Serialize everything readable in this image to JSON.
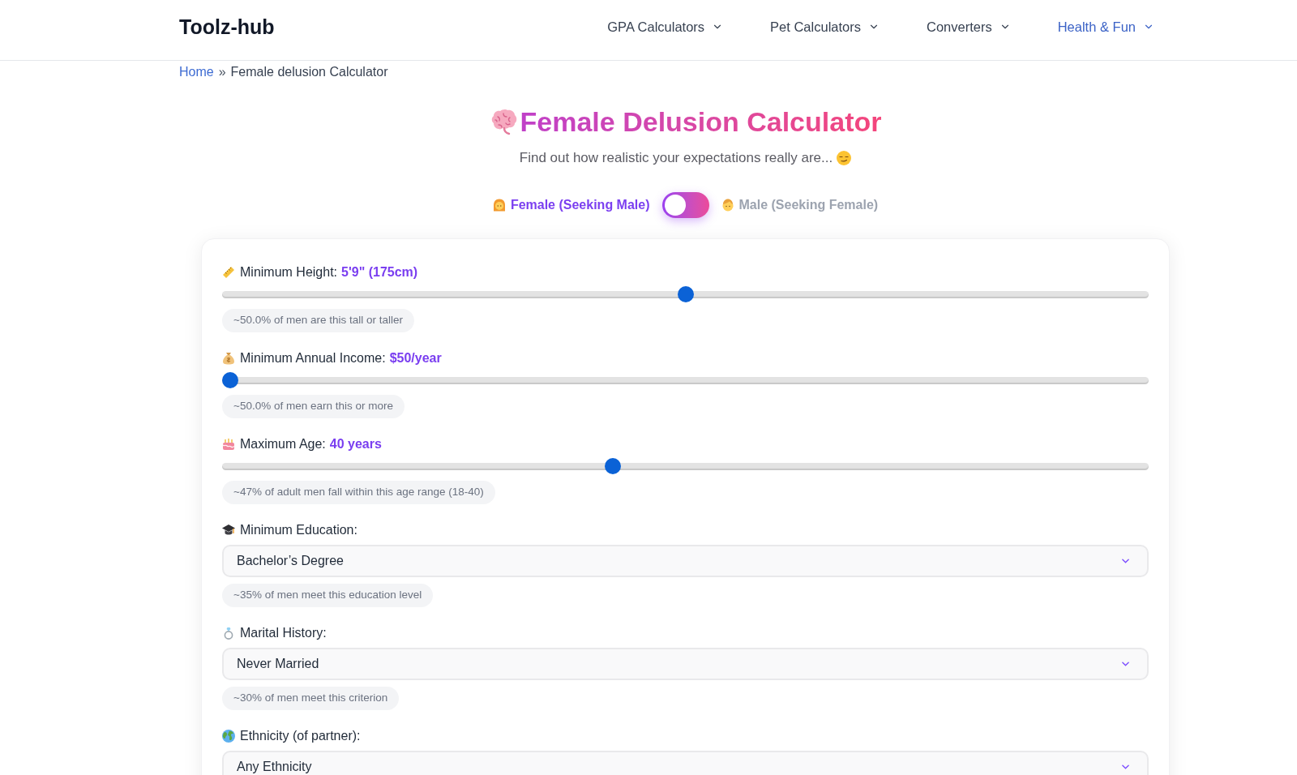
{
  "header": {
    "logo": "Toolz-hub",
    "nav": [
      {
        "label": "GPA Calculators",
        "selected": false
      },
      {
        "label": "Pet Calculators",
        "selected": false
      },
      {
        "label": "Converters",
        "selected": false
      },
      {
        "label": "Health & Fun",
        "selected": true
      }
    ]
  },
  "breadcrumb": {
    "links": [
      "Home"
    ],
    "separator": "»",
    "current": "Female delusion Calculator"
  },
  "hero": {
    "title": "Female Delusion Calculator",
    "subtitle": "Find out how realistic your expectations really are..."
  },
  "modes": [
    {
      "label": "Female (Seeking Male)",
      "selected": true
    },
    {
      "label": "Male (Seeking Female)",
      "selected": false
    }
  ],
  "criteria": [
    {
      "kind": "slider",
      "label": "Minimum Height:",
      "value": "5'9\" (175cm)",
      "level": 0.5,
      "note": "~50.0% of men are this tall or taller"
    },
    {
      "kind": "slider",
      "label": "Minimum Annual Income:",
      "value": "$50/year",
      "level": 0,
      "note": "~50.0% of men earn this or more"
    },
    {
      "kind": "slider",
      "label": "Maximum Age:",
      "value": "40 years",
      "level": 0.42,
      "note": "~47% of adult men fall within this age range (18-40)"
    },
    {
      "kind": "select",
      "label": "Minimum Education:",
      "value": "Bachelor’s Degree",
      "note": "~35% of men meet this education level"
    },
    {
      "kind": "select",
      "label": "Marital History:",
      "value": "Never Married",
      "note": "~30% of men meet this criterion"
    },
    {
      "kind": "select",
      "label": "Ethnicity (of partner):",
      "value": "Any Ethnicity"
    }
  ]
}
